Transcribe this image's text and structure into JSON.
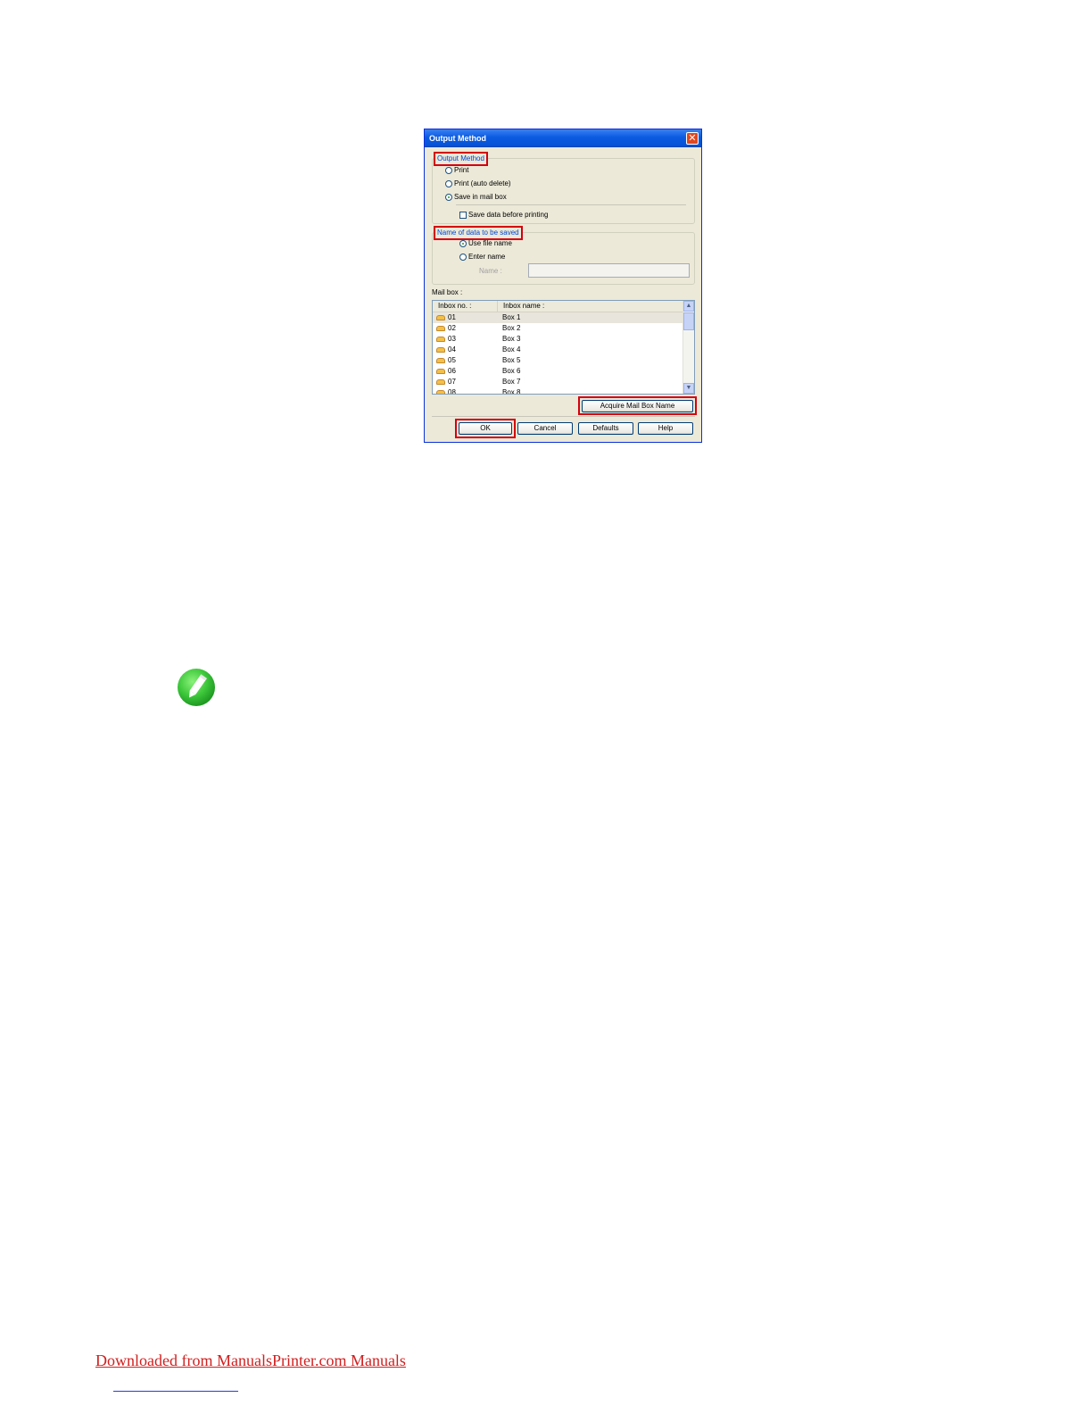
{
  "dialog": {
    "title": "Output Method",
    "close_glyph": "✕",
    "output_method": {
      "legend": "Output Method",
      "options": [
        "Print",
        "Print (auto delete)",
        "Save in mail box"
      ],
      "selected": "Save in mail box",
      "save_before_printing_label": "Save data before printing",
      "save_before_printing_checked": false
    },
    "name_of_data": {
      "legend": "Name of data to be saved",
      "options": [
        "Use file name",
        "Enter name"
      ],
      "selected": "Use file name",
      "name_label": "Name :",
      "name_value": ""
    },
    "mailbox": {
      "label": "Mail box :",
      "columns": [
        "Inbox no. :",
        "Inbox name :"
      ],
      "rows": [
        {
          "no": "01",
          "name": "Box 1"
        },
        {
          "no": "02",
          "name": "Box 2"
        },
        {
          "no": "03",
          "name": "Box 3"
        },
        {
          "no": "04",
          "name": "Box 4"
        },
        {
          "no": "05",
          "name": "Box 5"
        },
        {
          "no": "06",
          "name": "Box 6"
        },
        {
          "no": "07",
          "name": "Box 7"
        },
        {
          "no": "08",
          "name": "Box 8"
        }
      ],
      "selected_row": "01",
      "acquire_button": "Acquire Mail Box Name"
    },
    "buttons": {
      "ok": "OK",
      "cancel": "Cancel",
      "defaults": "Defaults",
      "help": "Help"
    }
  },
  "note_icon": "pencil-note-icon",
  "colors": {
    "highlight": "#d4000f",
    "note_icon_green": "#3cc63a",
    "footer_link": "#d21e1e"
  },
  "footer": {
    "link_text": "Downloaded from ManualsPrinter.com Manuals"
  }
}
